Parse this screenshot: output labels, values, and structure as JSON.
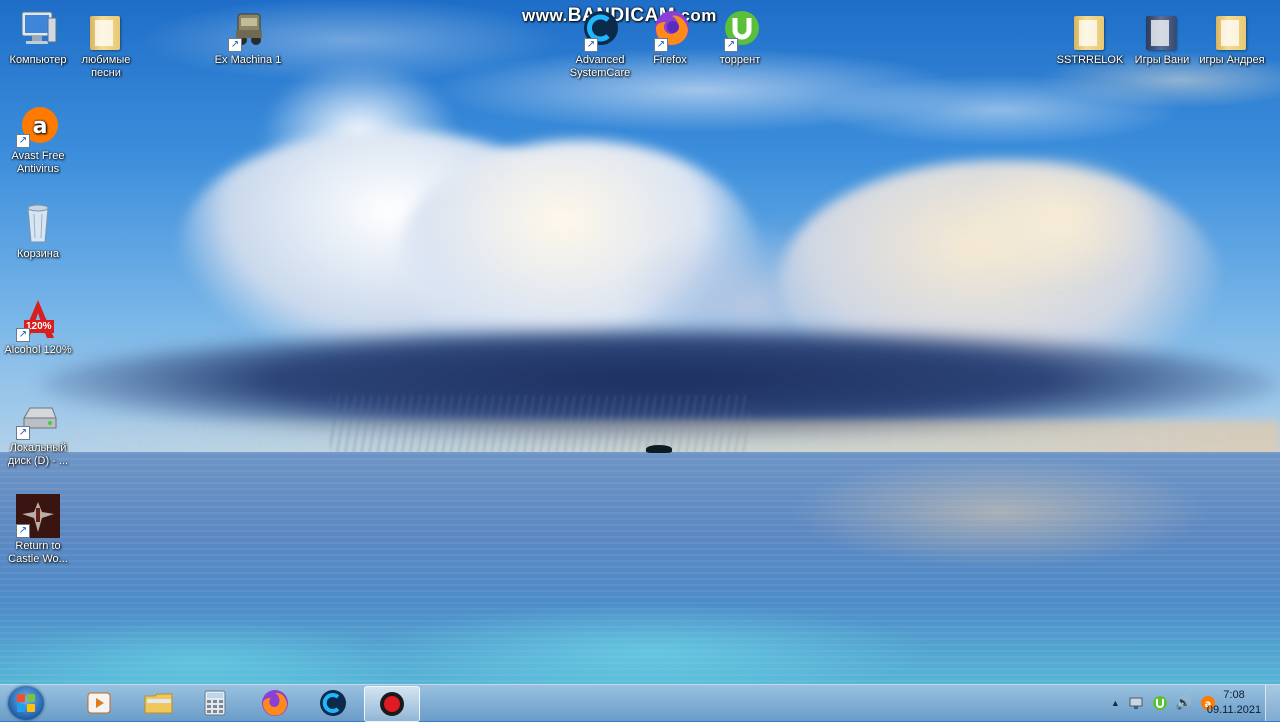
{
  "watermark": {
    "text_prefix": "www.",
    "text_main": "BANDICAM",
    "text_suffix": ".com"
  },
  "desktop_icons": [
    {
      "id": "computer",
      "label": "Компьютер",
      "icon": "computer-icon"
    },
    {
      "id": "favorite-songs",
      "label": "любимые песни",
      "icon": "folder-icon"
    },
    {
      "id": "ex-machina",
      "label": "Ex Machina 1",
      "icon": "ex-machina-icon"
    },
    {
      "id": "advanced-systemcare",
      "label": "Advanced SystemCare",
      "icon": "advanced-systemcare-icon"
    },
    {
      "id": "firefox",
      "label": "Firefox",
      "icon": "firefox-icon"
    },
    {
      "id": "torrent",
      "label": "торрент",
      "icon": "utorrent-icon"
    },
    {
      "id": "sstrrelok",
      "label": "SSTRRELOK",
      "icon": "folder-icon"
    },
    {
      "id": "igry-vani",
      "label": "Игры Вани",
      "icon": "folder-icon"
    },
    {
      "id": "igry-andreya",
      "label": "игры Андрея",
      "icon": "folder-icon"
    },
    {
      "id": "avast",
      "label": "Avast Free Antivirus",
      "icon": "avast-icon"
    },
    {
      "id": "recycle-bin",
      "label": "Корзина",
      "icon": "recycle-bin-icon"
    },
    {
      "id": "alcohol",
      "label": "Alcohol 120%",
      "icon": "alcohol-icon",
      "badge": "120%"
    },
    {
      "id": "local-disk",
      "label": "Локальный диск (D) - ...",
      "icon": "drive-icon"
    },
    {
      "id": "rtcw",
      "label": "Return to Castle Wo...",
      "icon": "rtcw-icon"
    }
  ],
  "taskbar": {
    "pinned": [
      {
        "id": "media-player",
        "icon": "media-player-icon"
      },
      {
        "id": "explorer",
        "icon": "folder-icon"
      },
      {
        "id": "calculator",
        "icon": "calculator-icon"
      },
      {
        "id": "firefox",
        "icon": "firefox-icon"
      },
      {
        "id": "advanced-systemcare",
        "icon": "advanced-systemcare-icon"
      },
      {
        "id": "bandicam",
        "icon": "record-icon",
        "active": true
      }
    ],
    "tray": {
      "expand_glyph": "▲",
      "volume_glyph": "🔊"
    },
    "clock": {
      "time": "7:08",
      "date": "09.11.2021"
    }
  },
  "colors": {
    "accent": "#1e6ec8",
    "taskbar": "#8fbcd8",
    "record": "#e01b24"
  }
}
